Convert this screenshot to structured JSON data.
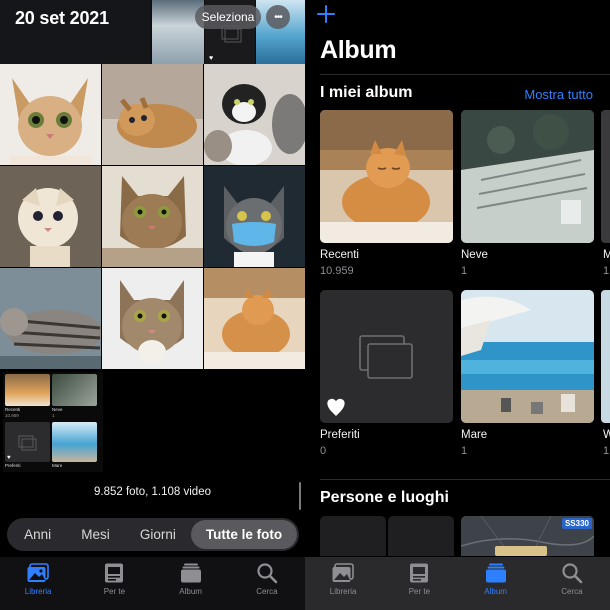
{
  "library": {
    "date_header": "20 set 2021",
    "select_label": "Seleziona",
    "more_label": "•••",
    "counts": "9.852 foto, 1.108 video",
    "segments": [
      {
        "label": "Anni",
        "active": false
      },
      {
        "label": "Mesi",
        "active": false
      },
      {
        "label": "Giorni",
        "active": false
      },
      {
        "label": "Tutte le foto",
        "active": true
      }
    ],
    "mini_albums": {
      "recenti": "Recenti",
      "recenti_count": "10.959",
      "neve": "Neve",
      "neve_count": "1",
      "preferiti": "Preferiti",
      "mare": "Mare"
    }
  },
  "albums_screen": {
    "title": "Album",
    "my_albums_title": "I miei album",
    "see_all": "Mostra tutto",
    "albums": [
      {
        "name": "Recenti",
        "count": "10.959"
      },
      {
        "name": "Neve",
        "count": "1"
      },
      {
        "name": "Preferiti",
        "count": "0"
      },
      {
        "name": "Mare",
        "count": "1"
      }
    ],
    "partial_names": [
      "M",
      "W"
    ],
    "partial_counts": [
      "1",
      "1"
    ],
    "people_places_title": "Persone e luoghi",
    "map_badge": "SS330"
  },
  "tabs": [
    {
      "label": "Libreria",
      "icon": "photos-library-icon"
    },
    {
      "label": "Per te",
      "icon": "for-you-icon"
    },
    {
      "label": "Album",
      "icon": "album-stack-icon"
    },
    {
      "label": "Cerca",
      "icon": "search-icon"
    }
  ],
  "left_active_tab": "Libreria",
  "right_active_tab": "Album",
  "colors": {
    "accent": "#2f80ff",
    "background": "#000000",
    "tabbar": "#111114",
    "segment": "#2a2a2e",
    "muted": "#8e8e93"
  }
}
